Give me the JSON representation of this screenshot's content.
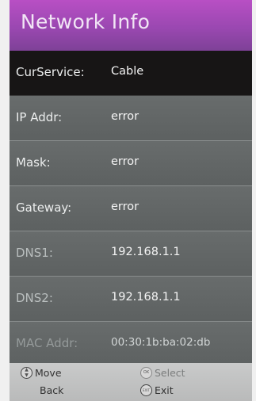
{
  "header": {
    "title": "Network Info"
  },
  "rows": [
    {
      "label": "CurService:",
      "value": "Cable"
    },
    {
      "label": "IP Addr:",
      "value": "error"
    },
    {
      "label": "Mask:",
      "value": "error"
    },
    {
      "label": "Gateway:",
      "value": "error"
    },
    {
      "label": "DNS1:",
      "value": "192.168.1.1"
    },
    {
      "label": "DNS2:",
      "value": "192.168.1.1"
    },
    {
      "label": "MAC Addr:",
      "value": "00:30:1b:ba:02:db"
    }
  ],
  "footer": {
    "move_label": "Move",
    "select_label": "Select",
    "back_label": "Back",
    "exit_label": "Exit",
    "ok_glyph": "OK",
    "exit_glyph": "EXIT",
    "move_glyph_up": "▲",
    "move_glyph_down": "▼"
  },
  "colors": {
    "header_top": "#b84fc4",
    "header_bottom": "#7e4197",
    "row_bg": "#5f6363",
    "selected_row_bg": "#171515",
    "footer_bg": "#c0c1c1"
  },
  "icons": {
    "move": "up-down-navigation-icon",
    "select": "ok-button-icon",
    "exit": "exit-button-icon"
  }
}
